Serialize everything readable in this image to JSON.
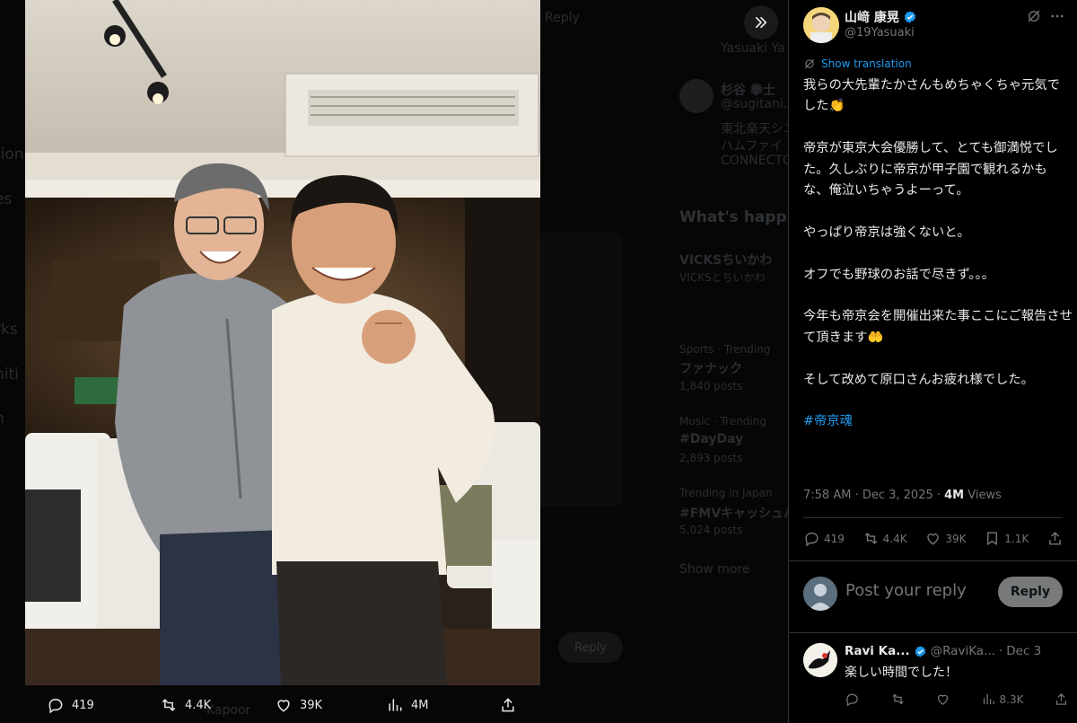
{
  "background": {
    "reply_label": "Reply",
    "author_partial": "Yasuaki Ya",
    "follow_suggestion": {
      "name": "杉谷 拳士",
      "handle": "@sugitani...",
      "bio1": "東北楽天シニ",
      "bio2": "ハムファイ",
      "bio3": "CONNECTO"
    },
    "whats_happening": "What's happ",
    "trends": [
      {
        "meta": "",
        "title": "VICKSちいかわ",
        "desc": "VICKSとちいかわ"
      },
      {
        "meta": "Sports · Trending",
        "title": "ファナック",
        "desc": "1,840 posts"
      },
      {
        "meta": "Music · Trending",
        "title": "#DayDay",
        "desc": "2,893 posts"
      },
      {
        "meta": "Trending in Japan",
        "title": "#FMVキャッシュバ",
        "desc": "5,024 posts"
      }
    ],
    "show_more": "Show more",
    "left_partials": [
      "tion",
      "es",
      "rks",
      "niti",
      "n"
    ],
    "bottom_reply_button": "Reply",
    "bottom_partial": "Kapoor"
  },
  "media_actions": {
    "replies": "419",
    "reposts": "4.4K",
    "likes": "39K",
    "views": "4M"
  },
  "post": {
    "author_name": "山﨑 康晃",
    "author_handle": "@19Yasuaki",
    "show_translation": "Show translation",
    "paragraphs": [
      "我らの大先輩たかさんもめちゃくちゃ元気でした👏",
      "帝京が東京大会優勝して、とても御満悦でした。久しぶりに帝京が甲子園で観れるかもな、俺泣いちゃうよーって。",
      "やっぱり帝京は強くないと。",
      "オフでも野球のお話で尽きず。。。",
      "今年も帝京会を開催出来た事ここにご報告させて頂きます🤲",
      "そして改めて原口さんお疲れ様でした。"
    ],
    "hashtag": "#帝京魂",
    "timestamp": "7:58 AM · Dec 3, 2025 · ",
    "views_count": "4M",
    "views_label": " Views",
    "stats": {
      "replies": "419",
      "reposts": "4.4K",
      "likes": "39K",
      "bookmarks": "1.1K"
    }
  },
  "composer": {
    "placeholder": "Post your reply",
    "reply_button": "Reply"
  },
  "reply": {
    "name": "Ravi Ka...",
    "handle": "@RaviKa...",
    "sep": " · ",
    "date": "Dec 3",
    "text": "楽しい時間でした！",
    "views": "8.3K"
  },
  "colors": {
    "accent": "#1d9bf0",
    "verified": "#1d9bf0",
    "muted": "#71767b",
    "text": "#e7e9ea",
    "border": "#2f3336"
  }
}
